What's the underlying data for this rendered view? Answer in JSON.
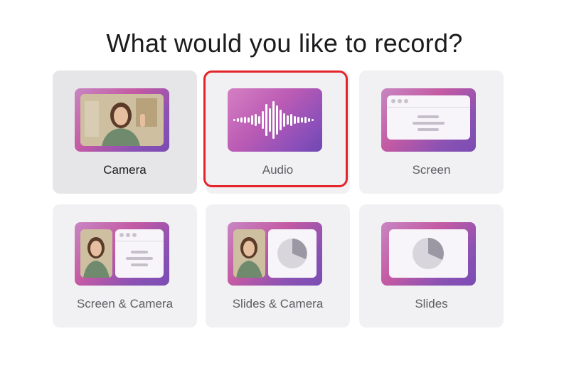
{
  "page": {
    "title": "What would you like to record?"
  },
  "options": [
    {
      "id": "camera",
      "label": "Camera",
      "selected": true
    },
    {
      "id": "audio",
      "label": "Audio",
      "highlighted": true
    },
    {
      "id": "screen",
      "label": "Screen"
    },
    {
      "id": "screen-camera",
      "label": "Screen & Camera"
    },
    {
      "id": "slides-camera",
      "label": "Slides & Camera"
    },
    {
      "id": "slides",
      "label": "Slides"
    }
  ],
  "colors": {
    "card_bg": "#f1f1f3",
    "card_selected_bg": "#e6e6e9",
    "highlight": "#e3242b",
    "thumb_gradient_start": "#c886c2",
    "thumb_gradient_end": "#7b4cb4"
  }
}
